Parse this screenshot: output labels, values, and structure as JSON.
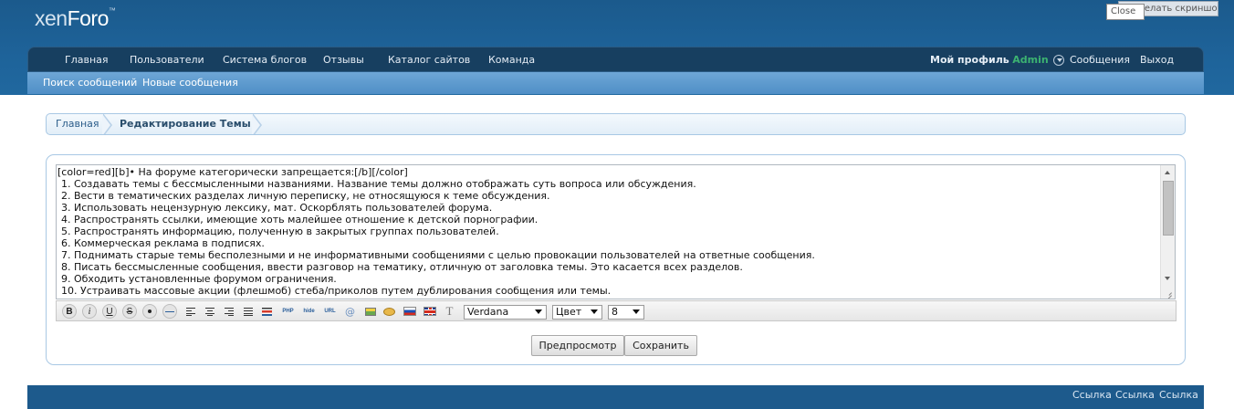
{
  "logo": {
    "xen": "xen",
    "foro": "Foro",
    "tm": "™"
  },
  "overlay": {
    "screenshot_label": "Сделать скриншот",
    "close_tooltip": "Close"
  },
  "nav": {
    "items": [
      "Главная",
      "Пользователи",
      "Система блогов",
      "Отзывы",
      "Каталог сайтов",
      "Команда"
    ],
    "profile_label": "Мой профиль",
    "username": "Admin",
    "messages": "Сообщения",
    "logout": "Выход"
  },
  "subnav": {
    "items": [
      "Поиск сообщений",
      "Новые сообщения"
    ]
  },
  "breadcrumb": {
    "home": "Главная",
    "current": "Редактирование Темы"
  },
  "editor": {
    "lines": [
      "[color=red][b]• На форуме категорически запрещается:[/b][/color]",
      "1. Создавать темы с бессмысленными названиями. Название темы должно отображать суть вопроса или обсуждения.",
      "2. Вести в тематических разделах личную переписку, не относящуюся к теме обсуждения.",
      "3. Использовать нецензурную лексику, мат. Оскорблять пользователей форума.",
      "4. Распространять ссылки, имеющие хоть малейшее отношение к детской порнографии.",
      "5. Распространять информацию, полученную в закрытых группах пользователей.",
      "6. Коммерческая реклама в подписях.",
      "7. Поднимать старые темы бесполезными и не информативными сообщениями с целью провокации пользователей на ответные сообщения.",
      "8. Писать бессмысленные сообщения, ввести разговор на тематику, отличную от заголовка темы. Это касается всех разделов.",
      "9. Обходить установленные форумом ограничения.",
      "10. Устраивать массовые акции (флешмоб) стеба/приколов путем дублирования сообщения или темы."
    ]
  },
  "toolbar": {
    "bold": "B",
    "italic": "i",
    "underline": "U",
    "strike": "S",
    "php_tag": "PHP",
    "hide_tag": "hide",
    "url_tag": "URL",
    "at_glyph": "@",
    "text_glyph": "T",
    "font_select": "Verdana",
    "color_select": "Цвет",
    "size_select": "8"
  },
  "actions": {
    "preview": "Предпросмотр",
    "save": "Сохранить"
  },
  "footer": {
    "links": [
      "Ссылка",
      "Ссылка",
      "Ссылка"
    ]
  }
}
